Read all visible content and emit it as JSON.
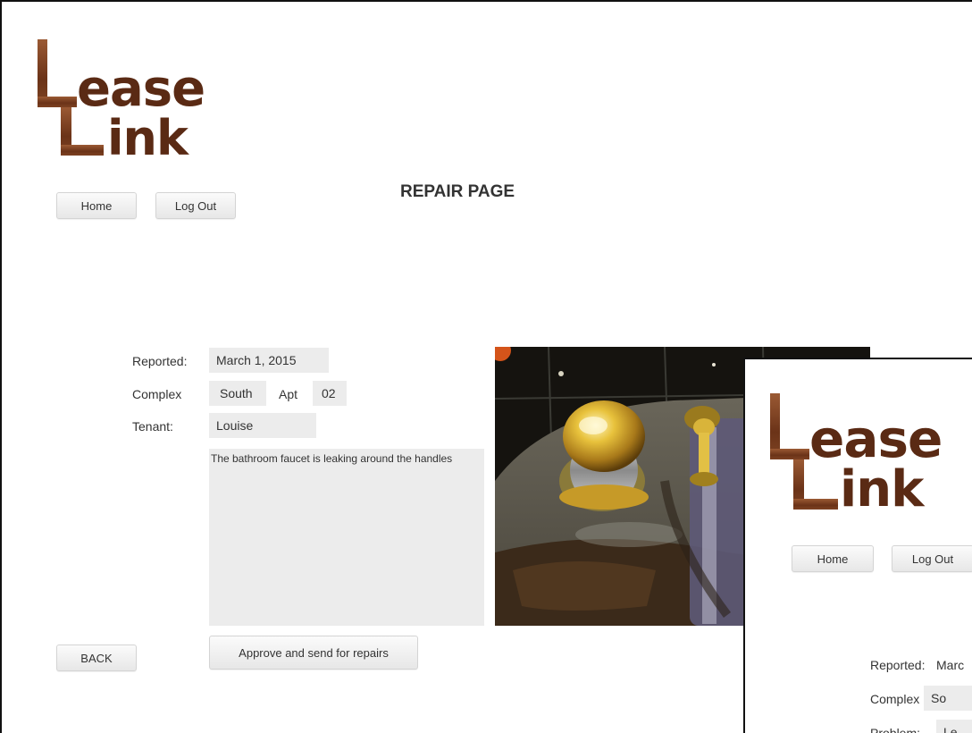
{
  "app": {
    "logo_word1": "ease",
    "logo_word2": "ink",
    "logo_text": "LeaseLink",
    "logo_color": "#5a2a14"
  },
  "nav": {
    "home_label": "Home",
    "logout_label": "Log Out"
  },
  "page": {
    "title": "REPAIR PAGE"
  },
  "repair": {
    "reported_label": "Reported:",
    "reported_value": "March 1, 2015",
    "complex_label": "Complex",
    "complex_value": "South",
    "apt_label": "Apt",
    "apt_value": "02",
    "tenant_label": "Tenant:",
    "tenant_value": "Louise",
    "description": "The bathroom faucet is leaking around the handles"
  },
  "actions": {
    "back_label": "BACK",
    "approve_label": "Approve and send for repairs"
  },
  "overlay": {
    "home_label": "Home",
    "logout_label": "Log Out",
    "reported_label": "Reported:",
    "reported_value": "Marc",
    "complex_label": "Complex",
    "complex_value": "So",
    "problem_label": "Problem:",
    "problem_value": "Le"
  },
  "photo": {
    "subject": "leaking bathroom faucet with brass handles"
  }
}
